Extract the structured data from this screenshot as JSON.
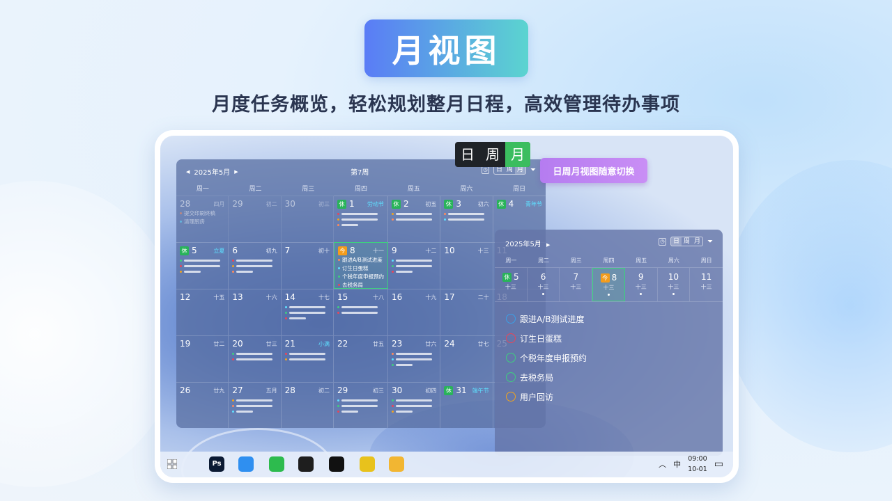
{
  "hero": {
    "title": "月视图",
    "subtitle": "月度任务概览，轻松规划整月日程，高效管理待办事项"
  },
  "switcher": {
    "options": [
      "日",
      "周",
      "月"
    ],
    "active": "月",
    "callout": "日周月视图随意切换"
  },
  "month_view": {
    "month_label": "2025年5月",
    "week_label": "第7周",
    "view_options": [
      "日",
      "周",
      "月"
    ],
    "weekdays": [
      "周一",
      "周二",
      "周三",
      "周四",
      "周五",
      "周六",
      "周日"
    ],
    "cells": [
      {
        "d": "28",
        "l": "四月",
        "dim": true,
        "events": [
          "提交印刷终稿",
          "清理厨房"
        ]
      },
      {
        "d": "29",
        "l": "初二",
        "dim": true
      },
      {
        "d": "30",
        "l": "初三",
        "dim": true
      },
      {
        "d": "1",
        "l": "劳动节",
        "rest": true,
        "fest": true,
        "bars": 3
      },
      {
        "d": "2",
        "l": "初五",
        "rest": true,
        "bars": 2
      },
      {
        "d": "3",
        "l": "初六",
        "rest": true,
        "bars": 2
      },
      {
        "d": "4",
        "l": "青年节",
        "rest": true,
        "fest": true
      },
      {
        "d": "5",
        "l": "立夏",
        "rest": true,
        "fest": true,
        "bars": 3
      },
      {
        "d": "6",
        "l": "初九",
        "bars": 3
      },
      {
        "d": "7",
        "l": "初十"
      },
      {
        "d": "8",
        "l": "十一",
        "today": true,
        "events": [
          "跟进A/B测试进度",
          "订生日蛋糕",
          "个税年度申报预约",
          "去税务局"
        ]
      },
      {
        "d": "9",
        "l": "十二",
        "bars": 3
      },
      {
        "d": "10",
        "l": "十三"
      },
      {
        "d": "11",
        "l": ""
      },
      {
        "d": "12",
        "l": "十五"
      },
      {
        "d": "13",
        "l": "十六"
      },
      {
        "d": "14",
        "l": "十七",
        "bars": 3
      },
      {
        "d": "15",
        "l": "十八",
        "bars": 2
      },
      {
        "d": "16",
        "l": "十九"
      },
      {
        "d": "17",
        "l": "二十"
      },
      {
        "d": "18",
        "l": ""
      },
      {
        "d": "19",
        "l": "廿二"
      },
      {
        "d": "20",
        "l": "廿三",
        "bars": 2
      },
      {
        "d": "21",
        "l": "小满",
        "fest": true,
        "bars": 2
      },
      {
        "d": "22",
        "l": "廿五"
      },
      {
        "d": "23",
        "l": "廿六",
        "bars": 3
      },
      {
        "d": "24",
        "l": "廿七"
      },
      {
        "d": "25",
        "l": ""
      },
      {
        "d": "26",
        "l": "廿九"
      },
      {
        "d": "27",
        "l": "五月",
        "bars": 3
      },
      {
        "d": "28",
        "l": "初二"
      },
      {
        "d": "29",
        "l": "初三",
        "bars": 3
      },
      {
        "d": "30",
        "l": "初四",
        "bars": 3
      },
      {
        "d": "31",
        "l": "端午节",
        "rest": true,
        "fest": true
      },
      {
        "d": "",
        "l": ""
      }
    ]
  },
  "week_view": {
    "month_label": "2025年5月",
    "view_options": [
      "日",
      "周",
      "月"
    ],
    "weekdays": [
      "周一",
      "周二",
      "周三",
      "周四",
      "周五",
      "周六",
      "周日"
    ],
    "days": [
      {
        "d": "5",
        "l": "十三",
        "rest": true
      },
      {
        "d": "6",
        "l": "十三",
        "dot": true
      },
      {
        "d": "7",
        "l": "十三"
      },
      {
        "d": "8",
        "l": "十三",
        "today": true,
        "dot": true
      },
      {
        "d": "9",
        "l": "十三",
        "dot": true
      },
      {
        "d": "10",
        "l": "十三",
        "dot": true
      },
      {
        "d": "11",
        "l": "十三"
      }
    ],
    "tasks": [
      {
        "text": "跟进A/B测试进度",
        "color": "#3aa0e8"
      },
      {
        "text": "订生日蛋糕",
        "color": "#e8455a"
      },
      {
        "text": "个税年度申报预约",
        "color": "#3ecf7f"
      },
      {
        "text": "去税务局",
        "color": "#3ecf7f"
      },
      {
        "text": "用户回访",
        "color": "#f3a41c"
      }
    ]
  },
  "badges": {
    "rest": "休",
    "today": "今"
  },
  "taskbar": {
    "apps": [
      {
        "name": "photoshop-icon",
        "label": "Ps",
        "color": "#0b1a33"
      },
      {
        "name": "browser-icon",
        "label": "",
        "color": "#2f8ff0"
      },
      {
        "name": "wechat-icon",
        "label": "",
        "color": "#2dbb4e"
      },
      {
        "name": "figma-icon",
        "label": "",
        "color": "#1e1e1e"
      },
      {
        "name": "qq-icon",
        "label": "",
        "color": "#111"
      },
      {
        "name": "plus-app-icon",
        "label": "",
        "color": "#e8c21c"
      },
      {
        "name": "folder-icon",
        "label": "",
        "color": "#f2b632"
      }
    ],
    "ime": "中",
    "time": "09:00",
    "date": "10-01"
  }
}
